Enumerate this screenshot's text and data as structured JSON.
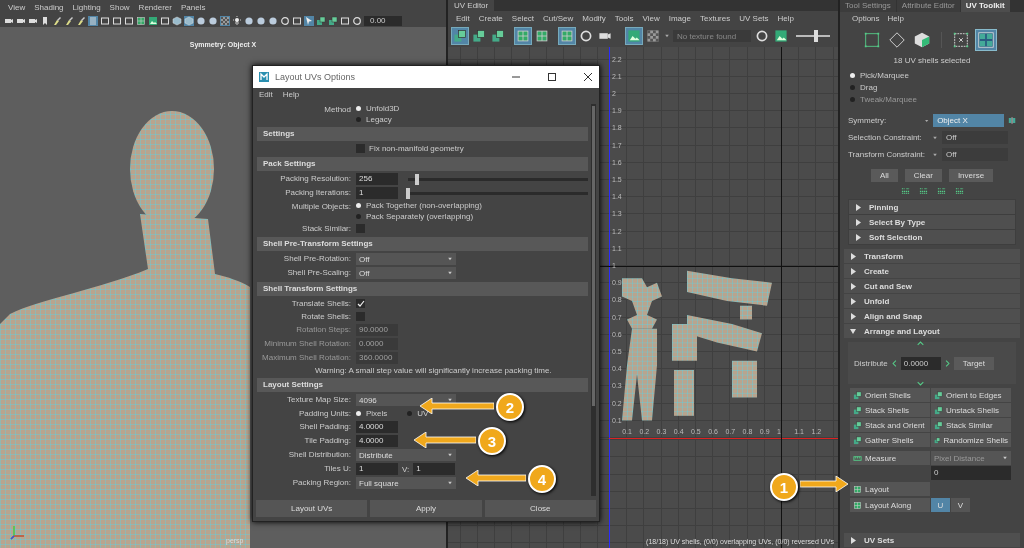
{
  "viewport": {
    "menu": [
      "View",
      "Shading",
      "Lighting",
      "Show",
      "Renderer",
      "Panels"
    ],
    "toolbar": [
      {
        "kind": "camera",
        "selected": false
      },
      {
        "kind": "camera",
        "selected": false
      },
      {
        "kind": "camera",
        "selected": false
      },
      {
        "kind": "bookmark",
        "selected": false
      },
      {
        "kind": "brush",
        "selected": false
      },
      {
        "kind": "brush",
        "selected": false
      },
      {
        "kind": "brush",
        "selected": false
      },
      {
        "kind": "list",
        "selected": true
      },
      {
        "kind": "box",
        "selected": false
      },
      {
        "kind": "box",
        "selected": false
      },
      {
        "kind": "box",
        "selected": false
      },
      {
        "kind": "grid",
        "selected": false
      },
      {
        "kind": "image",
        "selected": false
      },
      {
        "kind": "box",
        "selected": false
      },
      {
        "kind": "cube",
        "selected": false
      },
      {
        "kind": "cube",
        "selected": true
      },
      {
        "kind": "sphere",
        "selected": false
      },
      {
        "kind": "sphere",
        "selected": false
      },
      {
        "kind": "checker",
        "selected": true
      },
      {
        "kind": "light",
        "selected": false
      },
      {
        "kind": "sphere",
        "selected": false
      },
      {
        "kind": "sphere",
        "selected": false
      },
      {
        "kind": "sphere",
        "selected": false
      },
      {
        "kind": "circle",
        "selected": false
      },
      {
        "kind": "box",
        "selected": false
      },
      {
        "kind": "select",
        "selected": true
      },
      {
        "kind": "stack",
        "selected": false
      },
      {
        "kind": "stack",
        "selected": false
      },
      {
        "kind": "box",
        "selected": false
      },
      {
        "kind": "circle",
        "selected": false
      }
    ],
    "time_field": "0.00",
    "heading": "Symmetry: Object X",
    "camera_label": "persp"
  },
  "uv_editor": {
    "tab": "UV Editor",
    "menu": [
      "Edit",
      "Create",
      "Select",
      "Cut/Sew",
      "Modify",
      "Tools",
      "View",
      "Image",
      "Textures",
      "UV Sets",
      "Help"
    ],
    "toolbar": [
      {
        "kind": "stack",
        "selected": true
      },
      {
        "kind": "stack",
        "selected": false
      },
      {
        "kind": "stack",
        "selected": false
      },
      {
        "kind": "grid",
        "selected": true
      },
      {
        "kind": "grid",
        "selected": false
      },
      {
        "kind": "grid",
        "selected": true
      },
      {
        "kind": "circle",
        "selected": false
      },
      {
        "kind": "camera",
        "selected": false
      }
    ],
    "image_toolbar": [
      {
        "kind": "image",
        "selected": true
      },
      {
        "kind": "checker",
        "selected": false
      }
    ],
    "texture_field": {
      "placeholder": "No texture found"
    },
    "zoom_slider": {
      "level": 0.6
    },
    "v_labels": [
      "2.2",
      "2.1",
      "2",
      "1.9",
      "1.8",
      "1.7",
      "1.6",
      "1.5",
      "1.4",
      "1.3",
      "1.2",
      "1.1",
      "1",
      "0.9",
      "0.8",
      "0.7",
      "0.6",
      "0.5",
      "0.4",
      "0.3",
      "0.2",
      "0.1"
    ],
    "u_labels": [
      "0.1",
      "0.2",
      "0.3",
      "0.4",
      "0.5",
      "0.6",
      "0.7",
      "0.8",
      "0.9",
      "1",
      "1.1",
      "1.2"
    ],
    "status": "(18/18) UV shells, (0/0) overlapping UVs, (0/0) reversed UVs"
  },
  "dialog": {
    "title": "Layout UVs Options",
    "menu": [
      "Edit",
      "Help"
    ],
    "rows": [
      {
        "kind": "radio",
        "label": "Method",
        "options": [
          {
            "text": "Unfold3D",
            "selected": true
          },
          {
            "text": "Legacy",
            "selected": false
          }
        ]
      },
      {
        "kind": "section",
        "title": "Settings"
      },
      {
        "kind": "checkbox",
        "text": "Fix non-manifold geometry",
        "checked": false
      },
      {
        "kind": "section",
        "title": "Pack Settings"
      },
      {
        "kind": "slider",
        "label": "Packing Resolution:",
        "value": "256",
        "level": 0.05
      },
      {
        "kind": "slider",
        "label": "Packing Iterations:",
        "value": "1",
        "level": 0.0
      },
      {
        "kind": "radio",
        "label": "Multiple Objects:",
        "options": [
          {
            "text": "Pack Together (non-overlapping)",
            "selected": true
          },
          {
            "text": "Pack Separately (overlapping)",
            "selected": false
          }
        ]
      },
      {
        "kind": "checkbox",
        "label": "Stack Similar:",
        "checked": false
      },
      {
        "kind": "section",
        "title": "Shell Pre-Transform Settings"
      },
      {
        "kind": "dropdown",
        "label": "Shell Pre-Rotation:",
        "value": "Off"
      },
      {
        "kind": "dropdown",
        "label": "Shell Pre-Scaling:",
        "value": "Off"
      },
      {
        "kind": "section",
        "title": "Shell Transform Settings"
      },
      {
        "kind": "checkbox",
        "label": "Translate Shells:",
        "checked": true
      },
      {
        "kind": "checkbox",
        "label": "Rotate Shells:",
        "checked": false
      },
      {
        "kind": "field",
        "label": "Rotation Steps:",
        "value": "90.0000",
        "disabled": true
      },
      {
        "kind": "field",
        "label": "Minimum Shell Rotation:",
        "value": "0.0000",
        "disabled": true
      },
      {
        "kind": "field",
        "label": "Maximum Shell Rotation:",
        "value": "360.0000",
        "disabled": true
      },
      {
        "kind": "note",
        "text": "Warning: A small step value will significantly increase packing time."
      },
      {
        "kind": "section",
        "title": "Layout Settings"
      },
      {
        "kind": "dropdown",
        "label": "Texture Map Size:",
        "value": "4096"
      },
      {
        "kind": "radio_row",
        "label": "Padding Units:",
        "options": [
          {
            "text": "Pixels",
            "selected": true
          },
          {
            "text": "UV",
            "selected": false
          }
        ]
      },
      {
        "kind": "field",
        "label": "Shell Padding:",
        "value": "4.0000",
        "disabled": false
      },
      {
        "kind": "field",
        "label": "Tile Padding:",
        "value": "4.0000",
        "disabled": false
      },
      {
        "kind": "dropdown",
        "label": "Shell Distribution:",
        "value": "Distribute"
      },
      {
        "kind": "pair",
        "label": "Tiles U:",
        "value": "1",
        "label_2": "V:",
        "value_2": "1"
      },
      {
        "kind": "dropdown",
        "label": "Packing Region:",
        "value": "Full square"
      }
    ],
    "buttons": [
      "Layout UVs",
      "Apply",
      "Close"
    ]
  },
  "toolkit": {
    "tabs": [
      {
        "label": "Tool Settings",
        "selected": false
      },
      {
        "label": "Attribute Editor",
        "selected": false
      },
      {
        "label": "UV Toolkit",
        "selected": true
      }
    ],
    "menu": [
      "Options",
      "Help"
    ],
    "modes": [
      {
        "kind": "vertex",
        "selected": false
      },
      {
        "kind": "edge",
        "selected": false
      },
      {
        "kind": "face",
        "selected": false
      },
      {
        "kind": "uv",
        "selected": false
      },
      {
        "kind": "shell",
        "selected": true
      }
    ],
    "selection_info": "18 UV shells selected",
    "tools": [
      {
        "text": "Pick/Marquee",
        "selected": true,
        "disabled": false
      },
      {
        "text": "Drag",
        "selected": false,
        "disabled": false
      },
      {
        "text": "Tweak/Marquee",
        "selected": false,
        "disabled": true
      }
    ],
    "options": [
      {
        "label": "Symmetry:",
        "value": "Object X",
        "highlighted": true
      },
      {
        "label": "Selection Constraint:",
        "value": "Off",
        "highlighted": false
      },
      {
        "label": "Transform Constraint:",
        "value": "Off",
        "highlighted": false
      }
    ],
    "buttons": [
      "All",
      "Clear",
      "Inverse"
    ],
    "sub_sections": [
      {
        "title": "Pinning",
        "expanded": false
      },
      {
        "title": "Select By Type",
        "expanded": false
      },
      {
        "title": "Soft Selection",
        "expanded": false
      }
    ],
    "sections": [
      {
        "title": "Transform",
        "expanded": false
      },
      {
        "title": "Create",
        "expanded": false
      },
      {
        "title": "Cut and Sew",
        "expanded": false
      },
      {
        "title": "Unfold",
        "expanded": false
      },
      {
        "title": "Align and Snap",
        "expanded": false
      },
      {
        "title": "Arrange and Layout",
        "expanded": true
      }
    ],
    "distribute": {
      "label": "Distribute",
      "value": "0.0000",
      "button": "Target"
    },
    "tool_buttons": [
      "Orient Shells",
      "Orient to Edges",
      "Stack Shells",
      "Unstack Shells",
      "Stack and Orient",
      "Stack Similar",
      "Gather Shells",
      "Randomize Shells"
    ],
    "measure": {
      "label": "Measure",
      "dropdown": "Pixel Distance",
      "value": "0"
    },
    "layout": "Layout",
    "layout_along": {
      "label": "Layout Along",
      "axes": [
        {
          "label": "U",
          "selected": true
        },
        {
          "label": "V",
          "selected": false
        }
      ]
    },
    "bottom_sections": [
      {
        "title": "UV Sets",
        "expanded": false
      }
    ]
  },
  "annotations": [
    {
      "number": "1"
    },
    {
      "number": "2"
    },
    {
      "number": "3"
    },
    {
      "number": "4"
    }
  ]
}
